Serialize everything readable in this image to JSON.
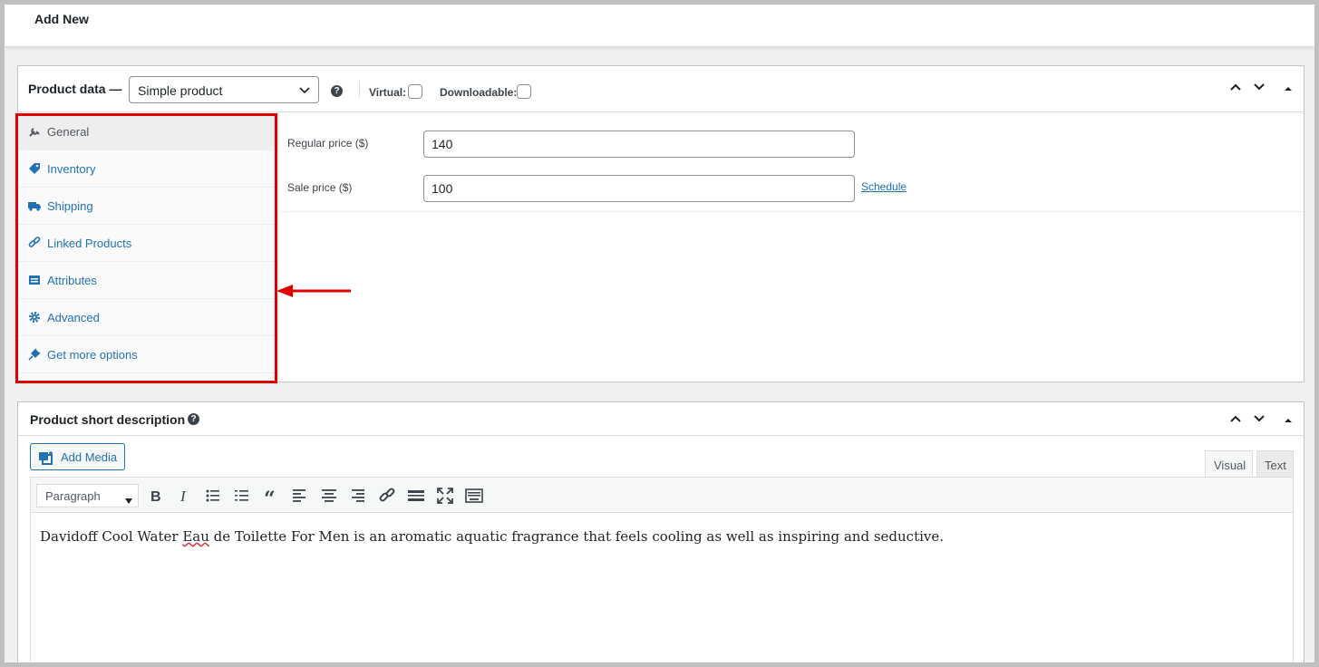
{
  "page": {
    "title": "Add New"
  },
  "product_data": {
    "title": "Product data —",
    "product_type": "Simple product",
    "virtual_label": "Virtual:",
    "downloadable_label": "Downloadable:",
    "tabs": [
      {
        "label": "General",
        "icon": "wrench-icon",
        "active": true
      },
      {
        "label": "Inventory",
        "icon": "tag-icon"
      },
      {
        "label": "Shipping",
        "icon": "truck-icon"
      },
      {
        "label": "Linked Products",
        "icon": "link-icon"
      },
      {
        "label": "Attributes",
        "icon": "list-icon"
      },
      {
        "label": "Advanced",
        "icon": "gear-icon"
      },
      {
        "label": "Get more options",
        "icon": "plugin-icon"
      }
    ],
    "regular_price_label": "Regular price ($)",
    "regular_price": "140",
    "sale_price_label": "Sale price ($)",
    "sale_price": "100",
    "schedule_link": "Schedule"
  },
  "short_description": {
    "title": "Product short description",
    "add_media": "Add Media",
    "visual_tab": "Visual",
    "text_tab": "Text",
    "format": "Paragraph",
    "content_before": "Davidoff Cool Water ",
    "content_misspelled": "Eau",
    "content_after": " de Toilette For Men is an aromatic aquatic fragrance that feels cooling as well as inspiring and seductive."
  },
  "colors": {
    "link": "#2271b1",
    "highlight_box": "#e00000"
  }
}
